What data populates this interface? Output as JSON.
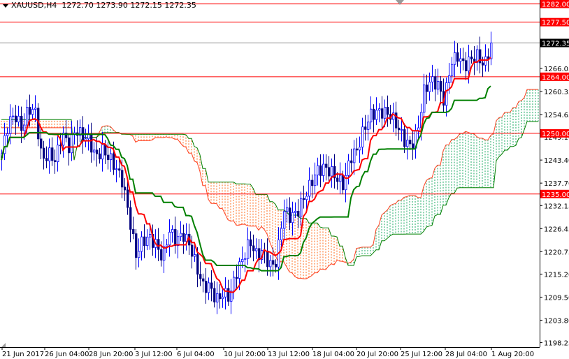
{
  "header": {
    "symbol": "XAUUSD,H4",
    "open": "1272.70",
    "high": "1273.90",
    "low": "1272.15",
    "close": "1272.35"
  },
  "chart_data": {
    "type": "candlestick",
    "indicators": [
      "Ichimoku (Tenkan-sen red, Kijun-sen green, Kumo cloud)"
    ],
    "ylim": [
      1198.25,
      1283
    ],
    "y_ticks": [
      "1282.00",
      "1277.50",
      "1272.35",
      "1266.05",
      "1264.00",
      "1260.35",
      "1254.65",
      "1250.00",
      "1249.10",
      "1243.40",
      "1237.70",
      "1235.00",
      "1232.15",
      "1226.45",
      "1220.75",
      "1215.20",
      "1209.50",
      "1203.80",
      "1198.25"
    ],
    "y_tick_values": [
      1266.05,
      1260.35,
      1254.65,
      1249.1,
      1243.4,
      1237.7,
      1232.15,
      1226.45,
      1220.75,
      1215.2,
      1209.5,
      1203.8,
      1198.25
    ],
    "x_ticks": [
      "21 Jun 2017",
      "26 Jun 04:00",
      "28 Jun 20:00",
      "3 Jul 12:00",
      "6 Jul 04:00",
      "10 Jul 20:00",
      "13 Jul 12:00",
      "18 Jul 04:00",
      "20 Jul 20:00",
      "25 Jul 12:00",
      "28 Jul 04:00",
      "1 Aug 20:00"
    ],
    "levels": [
      {
        "value": 1282.0,
        "label": "1282.00"
      },
      {
        "value": 1277.5,
        "label": "1277.50"
      },
      {
        "value": 1264.0,
        "label": "1264.00"
      },
      {
        "value": 1250.0,
        "label": "1250.00"
      },
      {
        "value": 1235.0,
        "label": "1235.00"
      }
    ],
    "current_price": {
      "value": 1272.35,
      "label": "1272.35"
    },
    "close_path": [
      1245.0,
      1252.8,
      1254.5,
      1251.0,
      1256.2,
      1255.3,
      1243.3,
      1245.0,
      1243.3,
      1250.2,
      1246.7,
      1251.0,
      1249.3,
      1248.4,
      1244.1,
      1245.8,
      1244.1,
      1241.5,
      1238.1,
      1229.4,
      1219.9,
      1223.4,
      1224.3,
      1222.5,
      1219.1,
      1226.0,
      1223.4,
      1225.1,
      1222.5,
      1217.3,
      1212.2,
      1212.2,
      1208.7,
      1210.4,
      1209.6,
      1215.6,
      1219.1,
      1223.4,
      1219.9,
      1220.8,
      1217.3,
      1218.2,
      1231.2,
      1229.4,
      1230.3,
      1233.8,
      1237.2,
      1240.7,
      1241.5,
      1240.7,
      1238.9,
      1237.2,
      1244.1,
      1245.8,
      1251.0,
      1254.5,
      1255.3,
      1255.3,
      1254.5,
      1251.9,
      1248.4,
      1246.7,
      1250.2,
      1260.5,
      1263.1,
      1262.2,
      1257.9,
      1267.4,
      1269.2,
      1266.6,
      1268.3,
      1269.2,
      1266.6,
      1272.35
    ],
    "colors": {
      "bull": "#0000ff",
      "bear": "#000080",
      "tenkan": "#ff0000",
      "kijun": "#008000",
      "cloud_bear": "#ff6a1a",
      "cloud_bull": "#18a860",
      "level": "#ff0000"
    }
  }
}
